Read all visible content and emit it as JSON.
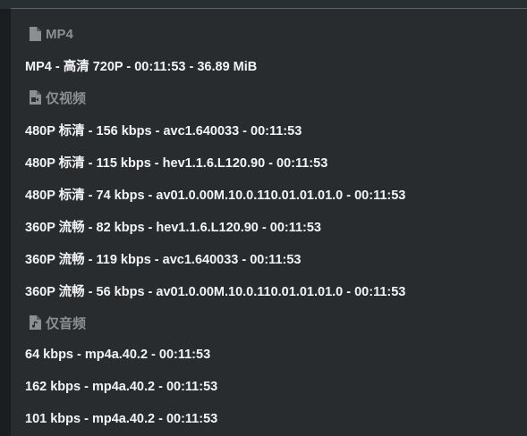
{
  "groups": [
    {
      "label": "MP4",
      "icon": "file-icon",
      "items": [
        "MP4 - 高清 720P - 00:11:53 - 36.89 MiB"
      ]
    },
    {
      "label": "仅视频",
      "icon": "file-video-icon",
      "items": [
        "480P 标清 - 156 kbps - avc1.640033 - 00:11:53",
        "480P 标清 - 115 kbps - hev1.1.6.L120.90 - 00:11:53",
        "480P 标清 - 74 kbps - av01.0.00M.10.0.110.01.01.01.0 - 00:11:53",
        "360P 流畅 - 82 kbps - hev1.1.6.L120.90 - 00:11:53",
        "360P 流畅 - 119 kbps - avc1.640033 - 00:11:53",
        "360P 流畅 - 56 kbps - av01.0.00M.10.0.110.01.01.01.0 - 00:11:53"
      ]
    },
    {
      "label": "仅音频",
      "icon": "file-audio-icon",
      "items": [
        "64 kbps - mp4a.40.2 - 00:11:53",
        "162 kbps - mp4a.40.2 - 00:11:53",
        "101 kbps - mp4a.40.2 - 00:11:53"
      ]
    }
  ],
  "colors": {
    "background": "#1b1e21",
    "menu_background": "#292c2f",
    "group_label": "#8c8f92",
    "item_text": "#f4f4f4"
  }
}
